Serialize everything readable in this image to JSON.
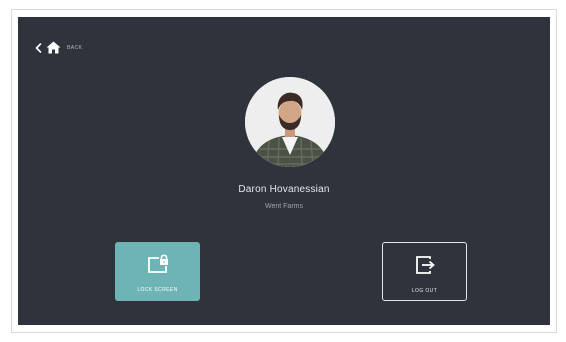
{
  "nav": {
    "back_label": "BACK",
    "back_icon": "chevron-left-icon",
    "home_icon": "home-icon"
  },
  "profile": {
    "name": "Daron Hovanessian",
    "organization": "Went Farms"
  },
  "actions": {
    "lock_label": "LOCK SCREEN",
    "lock_icon": "lock-screen-icon",
    "logout_label": "LOG OUT",
    "logout_icon": "log-out-icon"
  },
  "colors": {
    "background": "#2f333b",
    "accent": "#6fb4b5",
    "text_primary": "#e6e8ec",
    "text_secondary": "#9ea3ab"
  }
}
